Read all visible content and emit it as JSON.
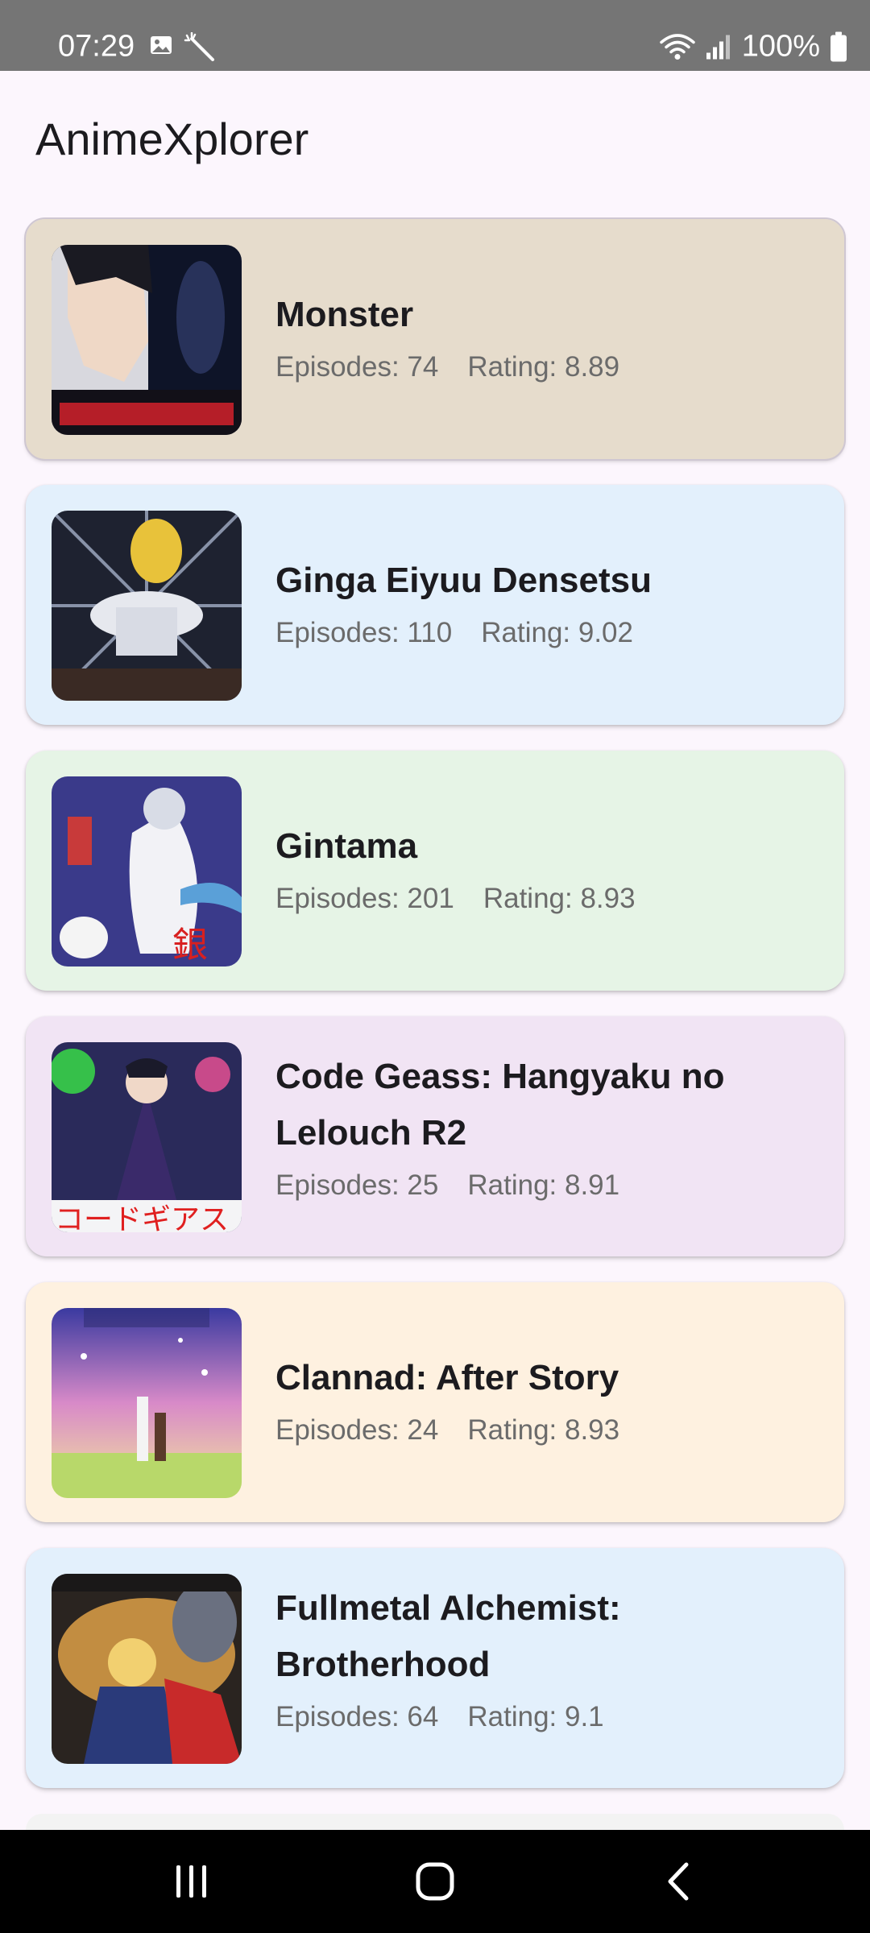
{
  "status_bar": {
    "time": "07:29",
    "battery": "100%",
    "icons": [
      "image-icon",
      "magic-wand-icon",
      "wifi-icon",
      "signal-icon",
      "battery-icon"
    ]
  },
  "app": {
    "title": "AnimeXplorer"
  },
  "anime": [
    {
      "title": "Monster",
      "episodes": "Episodes: 74",
      "rating": "Rating: 8.89",
      "bg": "#e6dccc"
    },
    {
      "title": "Ginga Eiyuu Densetsu",
      "episodes": "Episodes: 110",
      "rating": "Rating: 9.02",
      "bg": "#e3f0fc"
    },
    {
      "title": "Gintama",
      "episodes": "Episodes: 201",
      "rating": "Rating: 8.93",
      "bg": "#e6f4e6"
    },
    {
      "title": "Code Geass: Hangyaku no Lelouch R2",
      "episodes": "Episodes: 25",
      "rating": "Rating: 8.91",
      "bg": "#f1e4f4"
    },
    {
      "title": "Clannad: After Story",
      "episodes": "Episodes: 24",
      "rating": "Rating: 8.93",
      "bg": "#fef1e0"
    },
    {
      "title": "Fullmetal Alchemist: Brotherhood",
      "episodes": "Episodes: 64",
      "rating": "Rating: 9.1",
      "bg": "#e3f0fc"
    }
  ],
  "nav_bar": {
    "recents_icon": "recents-icon",
    "home_icon": "home-icon",
    "back_icon": "back-icon"
  }
}
